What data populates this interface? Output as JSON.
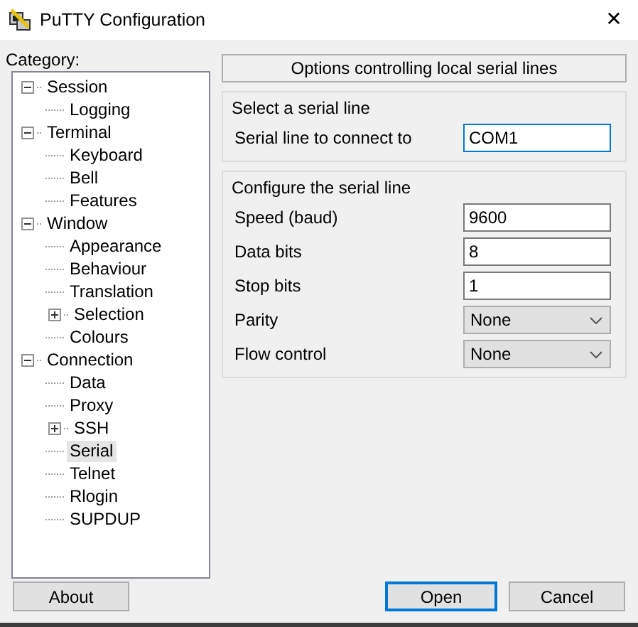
{
  "window": {
    "title": "PuTTY Configuration",
    "close": "✕"
  },
  "category_label": "Category:",
  "tree": [
    {
      "label": "Session",
      "selected": false,
      "expanded": true,
      "children": [
        {
          "label": "Logging",
          "selected": false
        }
      ]
    },
    {
      "label": "Terminal",
      "selected": false,
      "expanded": true,
      "children": [
        {
          "label": "Keyboard",
          "selected": false
        },
        {
          "label": "Bell",
          "selected": false
        },
        {
          "label": "Features",
          "selected": false
        }
      ]
    },
    {
      "label": "Window",
      "selected": false,
      "expanded": true,
      "children": [
        {
          "label": "Appearance",
          "selected": false
        },
        {
          "label": "Behaviour",
          "selected": false
        },
        {
          "label": "Translation",
          "selected": false
        },
        {
          "label": "Selection",
          "selected": false,
          "expanded": false
        },
        {
          "label": "Colours",
          "selected": false
        }
      ]
    },
    {
      "label": "Connection",
      "selected": false,
      "expanded": true,
      "children": [
        {
          "label": "Data",
          "selected": false
        },
        {
          "label": "Proxy",
          "selected": false
        },
        {
          "label": "SSH",
          "selected": false,
          "expanded": false
        },
        {
          "label": "Serial",
          "selected": true
        },
        {
          "label": "Telnet",
          "selected": false
        },
        {
          "label": "Rlogin",
          "selected": false
        },
        {
          "label": "SUPDUP",
          "selected": false
        }
      ]
    }
  ],
  "panel_header": "Options controlling local serial lines",
  "groups": [
    {
      "title": "Select a serial line",
      "fields": [
        {
          "kind": "text",
          "label": "Serial line to connect to",
          "value": "COM1",
          "focused": true
        }
      ]
    },
    {
      "title": "Configure the serial line",
      "fields": [
        {
          "kind": "text",
          "label": "Speed (baud)",
          "value": "9600",
          "focused": false
        },
        {
          "kind": "text",
          "label": "Data bits",
          "value": "8",
          "focused": false
        },
        {
          "kind": "text",
          "label": "Stop bits",
          "value": "1",
          "focused": false
        },
        {
          "kind": "select",
          "label": "Parity",
          "value": "None"
        },
        {
          "kind": "select",
          "label": "Flow control",
          "value": "None"
        }
      ]
    }
  ],
  "buttons": [
    {
      "label": "About",
      "default": false
    },
    {
      "label": "Open",
      "default": true
    },
    {
      "label": "Cancel",
      "default": false
    }
  ]
}
